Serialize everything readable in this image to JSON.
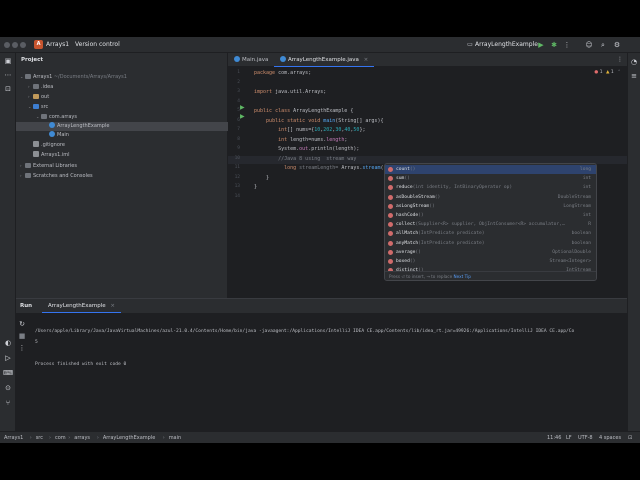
{
  "titlebar": {
    "project_badge": "A",
    "project_name": "Arrays1",
    "vcs_label": "Version control",
    "run_config": "ArrayLengthExample",
    "icons": [
      "hamburger-icon",
      "chevron-down-icon",
      "run-icon",
      "debug-icon",
      "more-icon",
      "profile-icon",
      "search-icon",
      "gear-icon"
    ]
  },
  "project_panel": {
    "title": "Project",
    "tree": [
      {
        "label": "Arrays1",
        "path": " ~/Documents/Arrays/Arrays1",
        "indent": 0,
        "icon": "folder",
        "chev": "v"
      },
      {
        "label": ".idea",
        "path": "",
        "indent": 1,
        "icon": "folder",
        "chev": ">"
      },
      {
        "label": "out",
        "path": "",
        "indent": 1,
        "icon": "folder-out",
        "chev": ">"
      },
      {
        "label": "src",
        "path": "",
        "indent": 1,
        "icon": "folder-src",
        "chev": "v"
      },
      {
        "label": "com.arrays",
        "path": "",
        "indent": 2,
        "icon": "folder",
        "chev": "v"
      },
      {
        "label": "ArrayLengthExample",
        "path": "",
        "indent": 3,
        "icon": "java",
        "chev": "",
        "selected": true
      },
      {
        "label": "Main",
        "path": "",
        "indent": 3,
        "icon": "java",
        "chev": ""
      },
      {
        "label": ".gitignore",
        "path": "",
        "indent": 1,
        "icon": "file",
        "chev": ""
      },
      {
        "label": "Arrays1.iml",
        "path": "",
        "indent": 1,
        "icon": "file",
        "chev": ""
      },
      {
        "label": "External Libraries",
        "path": "",
        "indent": 0,
        "icon": "folder",
        "chev": ">"
      },
      {
        "label": "Scratches and Consoles",
        "path": "",
        "indent": 0,
        "icon": "folder",
        "chev": ">"
      }
    ]
  },
  "editor": {
    "tabs": [
      {
        "label": "Main.java",
        "active": false
      },
      {
        "label": "ArrayLengthExample.java",
        "active": true
      }
    ],
    "inspections": {
      "errors": "1",
      "warnings": "1"
    },
    "lines": [
      {
        "n": "1",
        "html": "<span class=\"kw\">package</span> com.arrays;"
      },
      {
        "n": "2",
        "html": ""
      },
      {
        "n": "3",
        "html": "<span class=\"kw\">import</span> java.util.Arrays;"
      },
      {
        "n": "4",
        "html": ""
      },
      {
        "n": "5",
        "html": "<span class=\"kw\">public class</span> ArrayLengthExample {"
      },
      {
        "n": "6",
        "html": "    <span class=\"kw\">public static void</span> <span class=\"fn\">main</span>(String[] args){"
      },
      {
        "n": "7",
        "html": "        <span class=\"kw\">int</span>[] nums={<span class=\"num\">10</span>,<span class=\"num\">202</span>,<span class=\"num\">30</span>,<span class=\"num\">40</span>,<span class=\"num\">50</span>};"
      },
      {
        "n": "8",
        "html": "        <span class=\"kw\">int</span> length=nums.<span class=\"fld\">length</span>;"
      },
      {
        "n": "9",
        "html": "        System.<span class=\"fld\">out</span>.println(length);"
      },
      {
        "n": "10",
        "html": "        <span class=\"cm\">//Java 8 using  stream way</span>"
      },
      {
        "n": "11",
        "html": "          <span class=\"kw\">long</span> <span class=\"cm\">streamLength=</span> Arrays.<span class=\"fn\">stream</span>(nums)."
      },
      {
        "n": "12",
        "html": "    }"
      },
      {
        "n": "13",
        "html": "}"
      },
      {
        "n": "14",
        "html": ""
      }
    ]
  },
  "completion": {
    "items": [
      {
        "name": "count",
        "sig": "()",
        "type": "long",
        "selected": true
      },
      {
        "name": "sum",
        "sig": "()",
        "type": "int"
      },
      {
        "name": "reduce",
        "sig": "(int identity, IntBinaryOperator op)",
        "type": "int"
      },
      {
        "name": "asDoubleStream",
        "sig": "()",
        "type": "DoubleStream"
      },
      {
        "name": "asLongStream",
        "sig": "()",
        "type": "LongStream"
      },
      {
        "name": "hashCode",
        "sig": "()",
        "type": "int"
      },
      {
        "name": "collect",
        "sig": "(Supplier<R> supplier, ObjIntConsumer<R> accumulator,…",
        "type": "R"
      },
      {
        "name": "allMatch",
        "sig": "(IntPredicate predicate)",
        "type": "boolean"
      },
      {
        "name": "anyMatch",
        "sig": "(IntPredicate predicate)",
        "type": "boolean"
      },
      {
        "name": "average",
        "sig": "()",
        "type": "OptionalDouble"
      },
      {
        "name": "boxed",
        "sig": "()",
        "type": "Stream<Integer>"
      },
      {
        "name": "distinct",
        "sig": "()",
        "type": "IntStream"
      }
    ],
    "footer_hint": "Press ⏎ to insert, → to replace",
    "footer_link": "Next Tip"
  },
  "run_panel": {
    "title": "Run",
    "tab": "ArrayLengthExample",
    "output": [
      "/Users/apple/Library/Java/JavaVirtualMachines/azul-21.0.4/Contents/Home/bin/java -javaagent:/Applications/IntelliJ IDEA CE.app/Contents/lib/idea_rt.jar=49926:/Applications/IntelliJ IDEA CE.app/Co",
      "5",
      "",
      "Process finished with exit code 0"
    ]
  },
  "statusbar": {
    "breadcrumbs": [
      "Arrays1",
      "src",
      "com",
      "arrays",
      "ArrayLengthExample",
      "main"
    ],
    "position": "11:46",
    "line_sep": "LF",
    "encoding": "UTF-8",
    "indent": "4 spaces"
  }
}
